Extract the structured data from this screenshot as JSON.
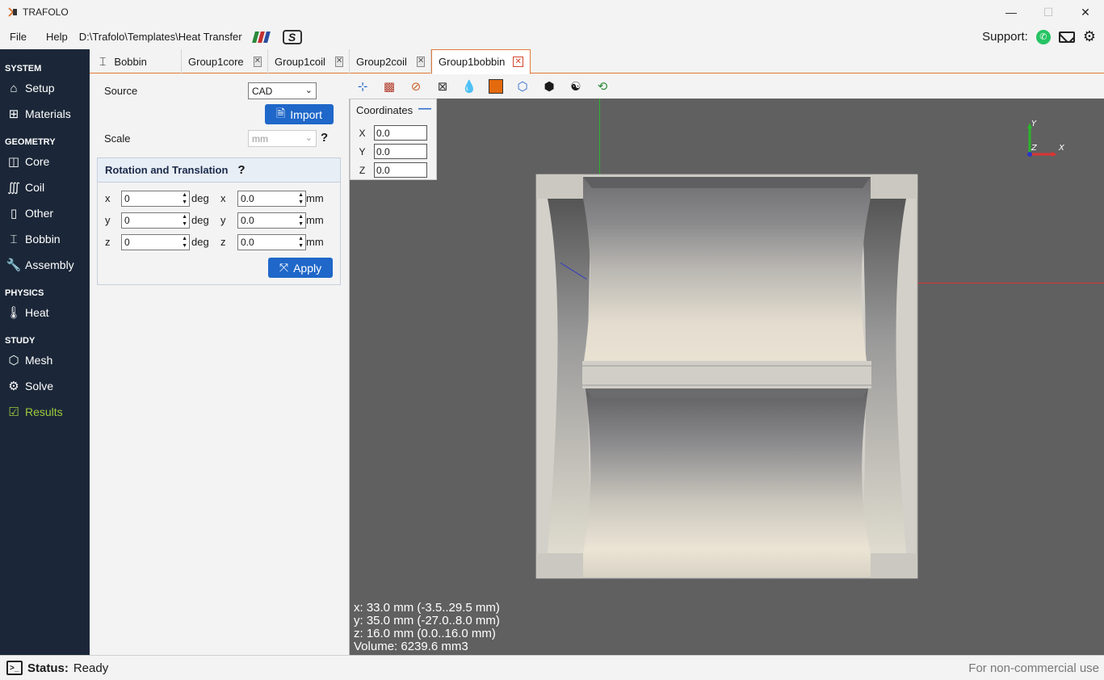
{
  "app": {
    "title": "TRAFOLO"
  },
  "window": {
    "minimize": "—",
    "maximize": "☐",
    "close": "✕"
  },
  "menu": {
    "file": "File",
    "help": "Help",
    "path": "D:\\Trafolo\\Templates\\Heat Transfer"
  },
  "support": {
    "label": "Support:"
  },
  "sidebar": {
    "system": "SYSTEM",
    "setup": "Setup",
    "materials": "Materials",
    "geometry": "GEOMETRY",
    "core": "Core",
    "coil": "Coil",
    "other": "Other",
    "bobbin": "Bobbin",
    "assembly": "Assembly",
    "physics": "PHYSICS",
    "heat": "Heat",
    "study": "STUDY",
    "mesh": "Mesh",
    "solve": "Solve",
    "results": "Results"
  },
  "tabs": {
    "t0": "Bobbin",
    "t1": "Group1core",
    "t2": "Group1coil",
    "t3": "Group2coil",
    "t4": "Group1bobbin"
  },
  "panel": {
    "source_label": "Source",
    "source_value": "CAD",
    "import_label": "Import",
    "scale_label": "Scale",
    "scale_value": "mm",
    "help": "?",
    "rt_title": "Rotation and Translation",
    "x": "x",
    "y": "y",
    "z": "z",
    "rot_x": "0",
    "rot_y": "0",
    "rot_z": "0",
    "tr_x": "0.0",
    "tr_y": "0.0",
    "tr_z": "0.0",
    "deg": "deg",
    "mm": "mm",
    "apply_label": "Apply"
  },
  "coords": {
    "title": "Coordinates",
    "minimize": "—",
    "X": "X",
    "Y": "Y",
    "Z": "Z",
    "x_val": "0.0",
    "y_val": "0.0",
    "z_val": "0.0"
  },
  "axes": {
    "y": "Y",
    "z": "Z",
    "x": "X"
  },
  "info": {
    "x": "x: 33.0 mm (-3.5..29.5 mm)",
    "y": "y: 35.0 mm (-27.0..8.0 mm)",
    "z": "z: 16.0 mm (0.0..16.0 mm)",
    "volume": "Volume: 6239.6 mm3"
  },
  "status": {
    "label": "Status:",
    "value": "Ready",
    "license": "For non-commercial use"
  },
  "colors": {
    "accent": "#e07b39",
    "sidebar_bg": "#1b2738",
    "button_blue": "#1f67c9",
    "active_green": "#9ecb3c"
  }
}
